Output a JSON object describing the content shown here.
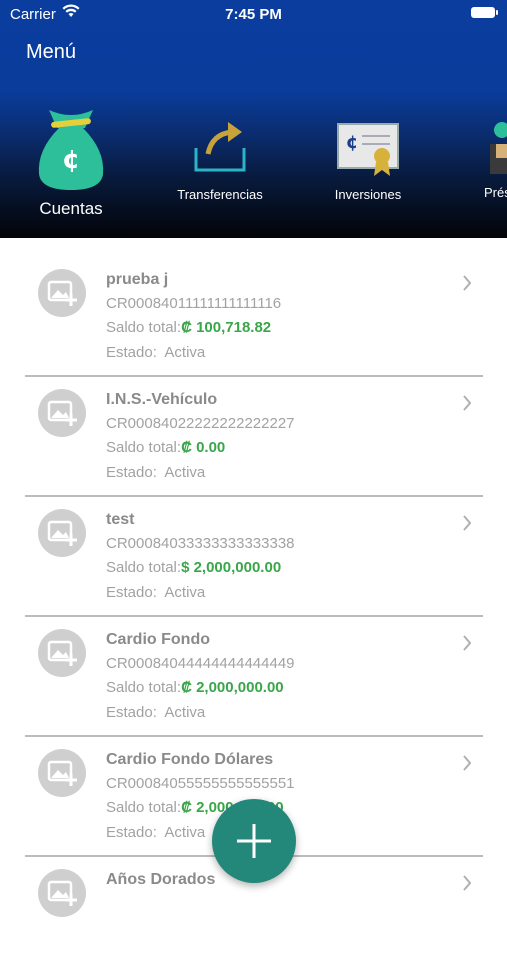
{
  "status_bar": {
    "carrier": "Carrier",
    "time": "7:45 PM"
  },
  "header": {
    "menu_title": "Menú"
  },
  "nav": [
    {
      "label": "Cuentas",
      "icon": "money-bag-icon",
      "active": true
    },
    {
      "label": "Transferencias",
      "icon": "transfer-arrow-icon"
    },
    {
      "label": "Inversiones",
      "icon": "certificate-icon"
    },
    {
      "label": "Prés",
      "icon": "loan-icon"
    }
  ],
  "labels": {
    "saldo": "Saldo total:",
    "estado": "Estado:"
  },
  "accounts": [
    {
      "name": "prueba j",
      "number": "CR00084011111111111116",
      "amount": "₡ 100,718.82",
      "status": "Activa"
    },
    {
      "name": "I.N.S.-Vehículo",
      "number": "CR00084022222222222227",
      "amount": "₡ 0.00",
      "status": "Activa"
    },
    {
      "name": "test",
      "number": "CR00084033333333333338",
      "amount": "$ 2,000,000.00",
      "status": "Activa"
    },
    {
      "name": "Cardio Fondo",
      "number": "CR00084044444444444449",
      "amount": "₡ 2,000,000.00",
      "status": "Activa"
    },
    {
      "name": "Cardio Fondo Dólares",
      "number": "CR00084055555555555551",
      "amount": "₡ 2,000,000.00",
      "status": "Activa"
    },
    {
      "name": "Años Dorados",
      "number": "",
      "amount": "",
      "status": ""
    }
  ],
  "fab": {
    "icon": "plus-icon"
  },
  "colors": {
    "header_top": "#0a3d9e",
    "header_bottom": "#030408",
    "amount": "#3aa64a",
    "fab": "#23887a"
  }
}
